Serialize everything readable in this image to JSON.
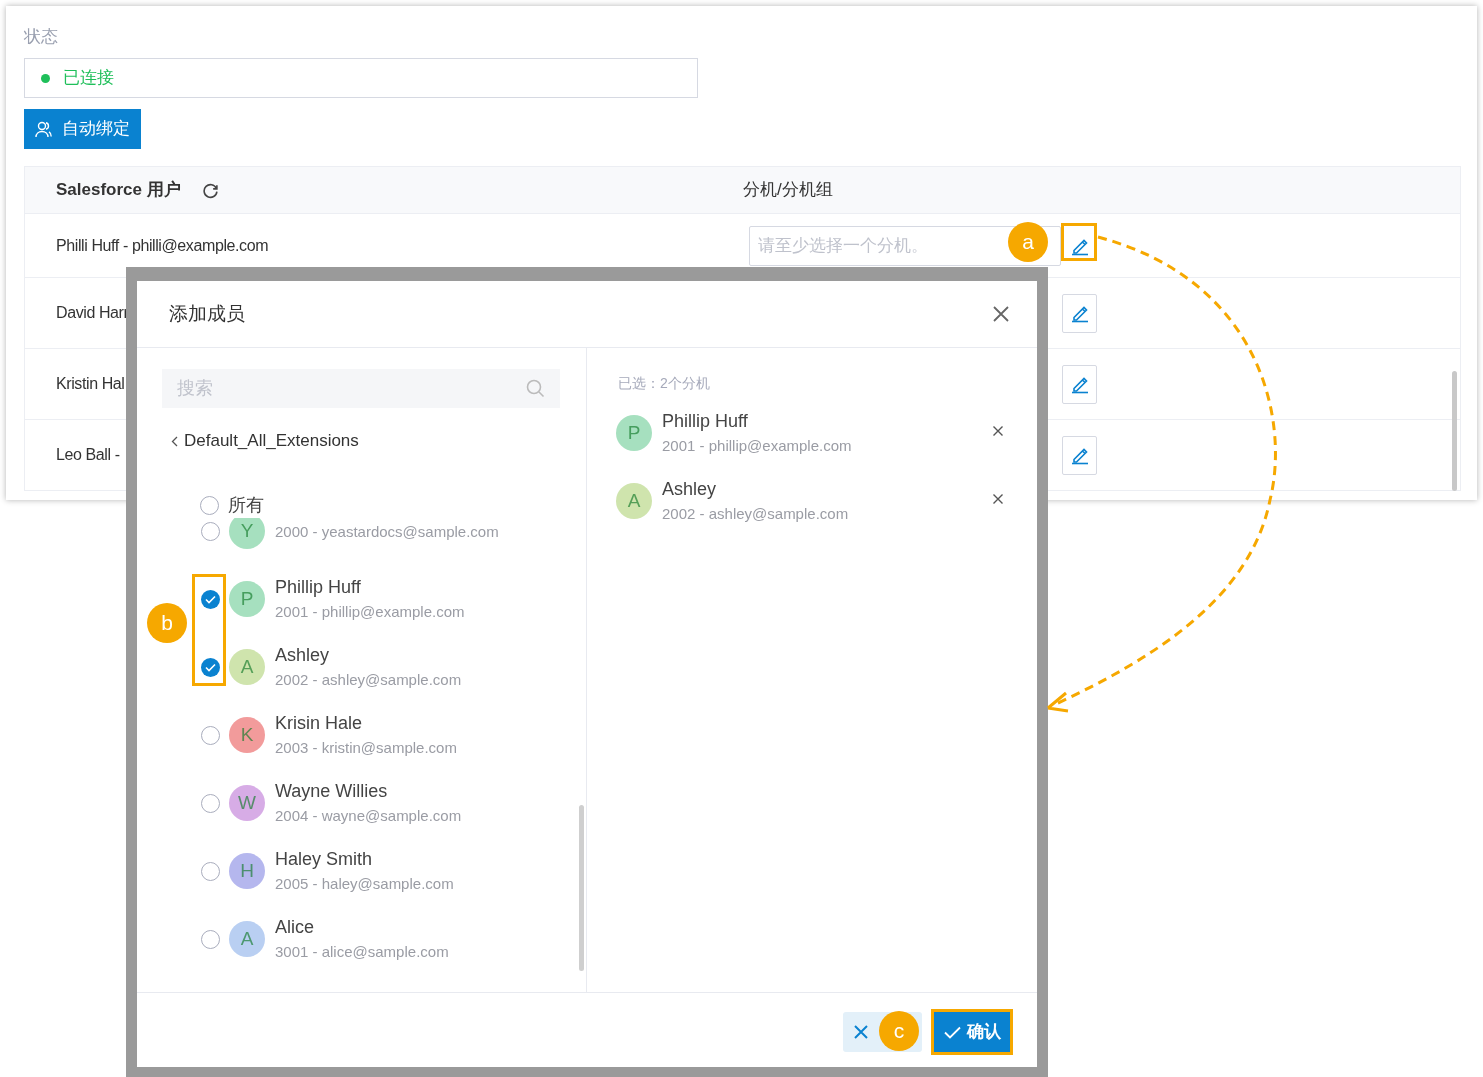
{
  "status": {
    "label": "状态",
    "value": "已连接",
    "color": "#1fbf5a"
  },
  "auto_bind_button": "自动绑定",
  "table": {
    "columns": [
      "Salesforce 用户",
      "分机/分机组"
    ],
    "rows": [
      {
        "user": "Philli Huff - philli@example.com",
        "placeholder": "请至少选择一个分机。"
      },
      {
        "user": "David Harr"
      },
      {
        "user": "Kristin Hal"
      },
      {
        "user": "Leo Ball -"
      }
    ]
  },
  "dialog": {
    "title": "添加成员",
    "search": {
      "placeholder": "搜索"
    },
    "group": "Default_All_Extensions",
    "all_option": {
      "label": "所有",
      "checked": false
    },
    "items": [
      {
        "initial": "Y",
        "detail": "2000 - yeastardocs@sample.com",
        "checked": false,
        "color": "#a6e0bf"
      },
      {
        "initial": "P",
        "name": "Phillip Huff",
        "detail": "2001 - phillip@example.com",
        "checked": true,
        "color": "#a6e0bf"
      },
      {
        "initial": "A",
        "name": "Ashley",
        "detail": "2002 - ashley@sample.com",
        "checked": true,
        "color": "#cfe4ad"
      },
      {
        "initial": "K",
        "name": "Krisin Hale",
        "detail": "2003 - kristin@sample.com",
        "checked": false,
        "color": "#f29b9b"
      },
      {
        "initial": "W",
        "name": "Wayne Willies",
        "detail": "2004 - wayne@sample.com",
        "checked": false,
        "color": "#d7ace6"
      },
      {
        "initial": "H",
        "name": "Haley Smith",
        "detail": "2005 - haley@sample.com",
        "checked": false,
        "color": "#b5b7ee"
      },
      {
        "initial": "A",
        "name": "Alice",
        "detail": "3001 - alice@sample.com",
        "checked": false,
        "color": "#b9cff2"
      }
    ],
    "selected_label": "已选：2个分机",
    "selected": [
      {
        "initial": "P",
        "name": "Phillip Huff",
        "detail": "2001 - phillip@example.com",
        "color": "#a6e0bf"
      },
      {
        "initial": "A",
        "name": "Ashley",
        "detail": "2002 - ashley@sample.com",
        "color": "#cfe4ad"
      }
    ],
    "confirm_button": "确认"
  },
  "annotations": [
    {
      "label": "a"
    },
    {
      "label": "b"
    },
    {
      "label": "c"
    }
  ]
}
